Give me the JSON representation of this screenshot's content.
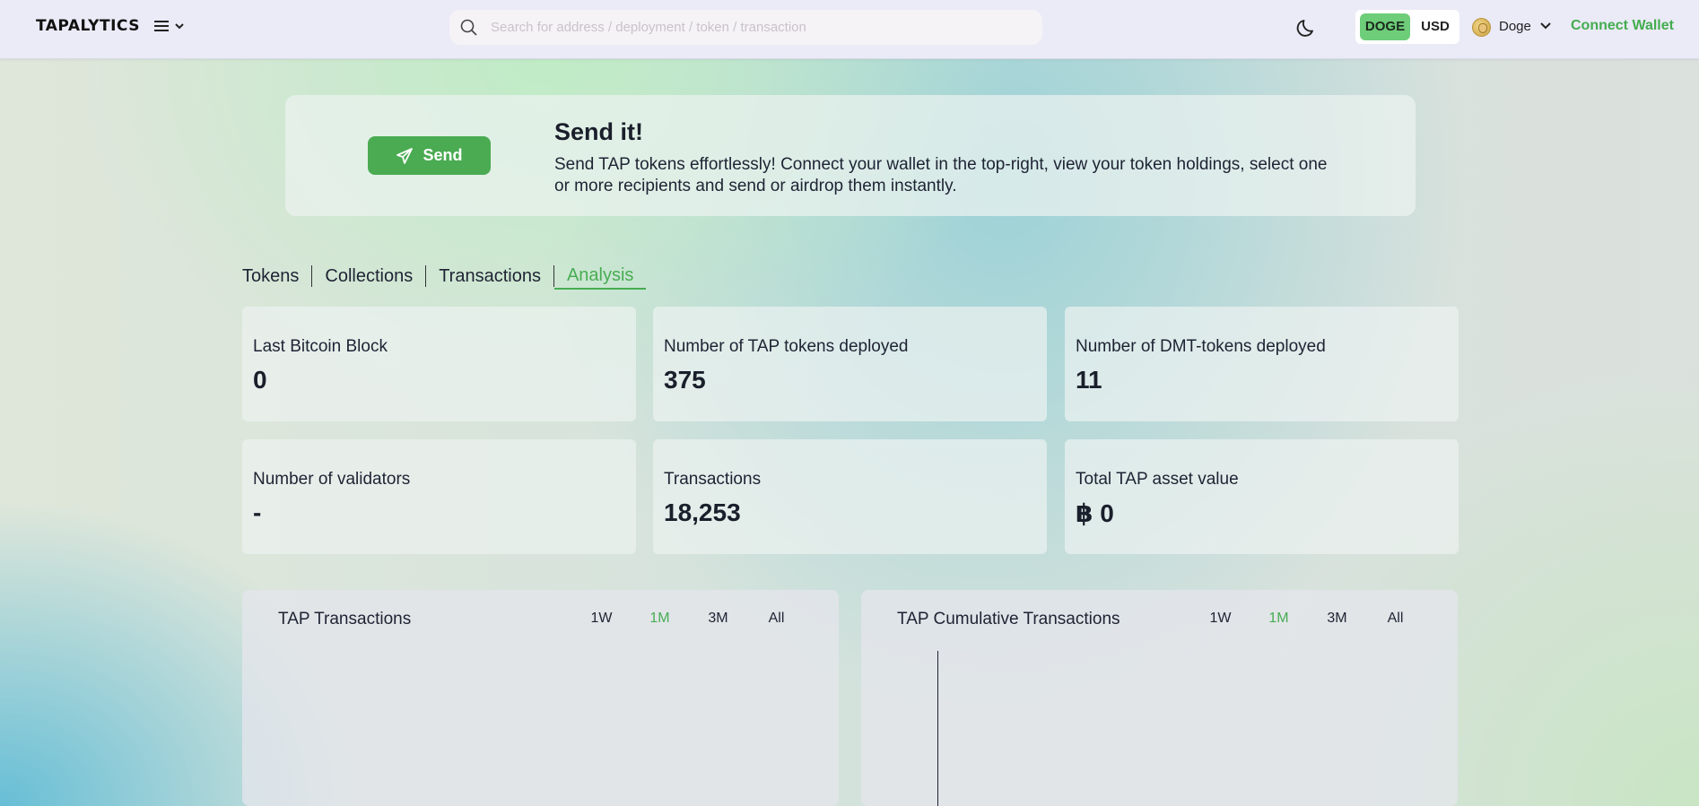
{
  "header": {
    "logo": "TAPALYTICS",
    "search_placeholder": "Search for address / deployment / token / transaction",
    "currency_options": [
      "DOGE",
      "USD"
    ],
    "currency_selected": "DOGE",
    "network": "Doge",
    "connect_label": "Connect Wallet"
  },
  "banner": {
    "button_label": "Send",
    "title": "Send it!",
    "text": "Send TAP tokens effortlessly! Connect your wallet in the top-right, view your token holdings, select one or more recipients and send or airdrop them instantly."
  },
  "tabs": [
    {
      "label": "Tokens",
      "active": false
    },
    {
      "label": "Collections",
      "active": false
    },
    {
      "label": "Transactions",
      "active": false
    },
    {
      "label": "Analysis",
      "active": true
    }
  ],
  "stats": [
    {
      "label": "Last Bitcoin Block",
      "value": "0"
    },
    {
      "label": "Number of TAP tokens deployed",
      "value": "375"
    },
    {
      "label": "Number of DMT-tokens deployed",
      "value": "11"
    },
    {
      "label": "Number of validators",
      "value": "-"
    },
    {
      "label": "Transactions",
      "value": "18,253"
    },
    {
      "label": "Total TAP asset value",
      "value": "฿ 0"
    }
  ],
  "charts": [
    {
      "title": "TAP Transactions",
      "ranges": [
        "1W",
        "1M",
        "3M",
        "All"
      ],
      "selected_range": "1M"
    },
    {
      "title": "TAP Cumulative Transactions",
      "ranges": [
        "1W",
        "1M",
        "3M",
        "All"
      ],
      "selected_range": "1M"
    }
  ],
  "colors": {
    "accent": "#47ad52",
    "send_button": "#4aab52",
    "doge_toggle": "#6dcd78",
    "header_bg": "#ebeaf7"
  }
}
